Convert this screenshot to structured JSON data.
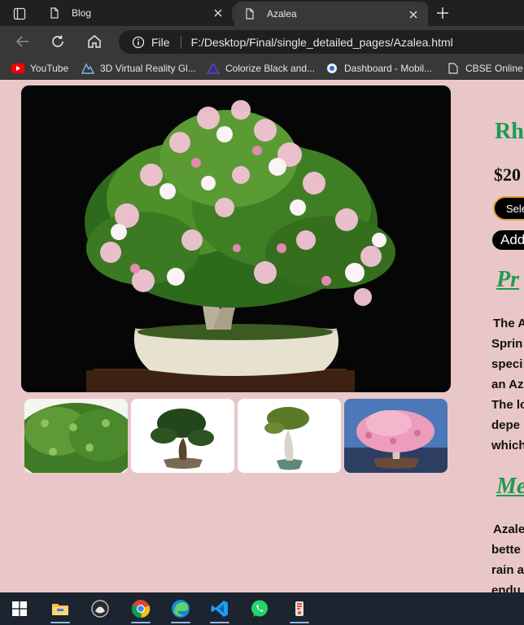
{
  "browser": {
    "tabs": [
      {
        "title": "Blog",
        "active": false
      },
      {
        "title": "Azalea",
        "active": true
      }
    ],
    "address": {
      "scheme": "File",
      "url": "F:/Desktop/Final/single_detailed_pages/Azalea.html"
    },
    "bookmarks": [
      {
        "label": "YouTube",
        "icon": "youtube-icon"
      },
      {
        "label": "3D Virtual Reality Gl...",
        "icon": "vr-icon"
      },
      {
        "label": "Colorize Black and...",
        "icon": "colorize-icon"
      },
      {
        "label": "Dashboard - Mobil...",
        "icon": "dashboard-icon"
      },
      {
        "label": "CBSE Online -",
        "icon": "page-icon"
      }
    ]
  },
  "product": {
    "title": "Rh",
    "price": "$20",
    "select_label": "Sele",
    "add_label": "Add",
    "main_image": "azalea-bonsai-photo",
    "thumbnails": [
      "azalea-leaves-closeup",
      "bonsai-tree-1",
      "bonsai-tree-2",
      "pink-azalea-bonsai"
    ]
  },
  "sections": [
    {
      "heading": "Pr",
      "lines": [
        "The A",
        "Sprin",
        "speci",
        "an Az",
        "The lo",
        "depe",
        "which"
      ]
    },
    {
      "heading": "Me",
      "lines": [
        "Azale",
        "bette",
        "rain a",
        "endu"
      ]
    }
  ],
  "taskbar": {
    "apps": [
      "windows-start-icon",
      "file-explorer-icon",
      "inkscape-icon",
      "chrome-icon",
      "edge-icon",
      "vscode-icon",
      "whatsapp-icon",
      "git-gui-icon"
    ]
  },
  "colors": {
    "page_bg": "#e9c7c8",
    "heading_green": "#1f9a50",
    "button_border": "#e6a23c"
  }
}
